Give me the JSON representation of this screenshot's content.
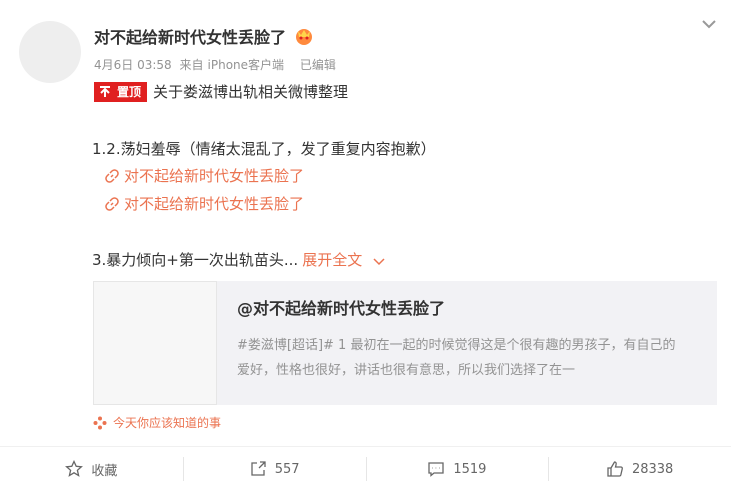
{
  "post": {
    "author": "对不起给新时代女性丢脸了",
    "timestamp": "4月6日 03:58",
    "source_prefix": "来自",
    "source_app": "iPhone客户端",
    "edited": "已编辑",
    "pin_badge": "置顶",
    "pin_title": "关于娄滋博出轨相关微博整理",
    "line1": "1.2.荡妇羞辱（情绪太混乱了，发了重复内容抱歉）",
    "links": [
      "对不起给新时代女性丢脸了",
      "对不起给新时代女性丢脸了"
    ],
    "line2": "3.暴力倾向+第一次出轨苗头...",
    "expand": "展开全文"
  },
  "card": {
    "title": "@对不起给新时代女性丢脸了",
    "summary": "#娄滋博[超话]# 1 最初在一起的时候觉得这是个很有趣的男孩子，有自己的爱好，性格也很好，讲话也很有意思，所以我们选择了在一"
  },
  "topic": {
    "label": "今天你应该知道的事"
  },
  "actions": {
    "favorite": "收藏",
    "repost": "557",
    "comment": "1519",
    "like": "28338"
  },
  "colors": {
    "accent": "#eb7350",
    "pin_red": "#e02020",
    "meta_gray": "#939393"
  },
  "icons": [
    "vip-badge-icon",
    "chevron-down-icon",
    "pin-icon",
    "link-icon",
    "sparkle-icon",
    "star-icon",
    "repost-icon",
    "comment-icon",
    "thumbs-up-icon"
  ]
}
